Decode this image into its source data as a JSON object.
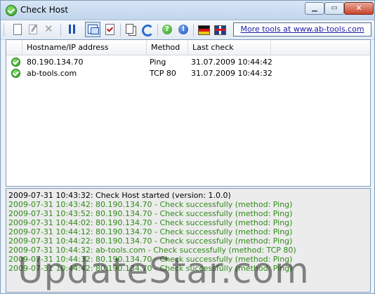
{
  "window": {
    "title": "Check Host"
  },
  "toolbar": {
    "buttons": [
      "new-icon",
      "edit-icon",
      "delete-icon",
      "pause-icon",
      "window-icon",
      "checklist-icon",
      "copy-icon",
      "refresh-icon",
      "help-icon",
      "info-icon",
      "german-flag-icon",
      "uk-flag-icon"
    ],
    "more_tools_label": "More tools at www.ab-tools.com"
  },
  "list": {
    "columns": [
      "Hostname/IP address",
      "Method",
      "Last check"
    ],
    "rows": [
      {
        "host": "80.190.134.70",
        "method": "Ping",
        "last_check": "31.07.2009 10:44:42"
      },
      {
        "host": "ab-tools.com",
        "method": "TCP 80",
        "last_check": "31.07.2009 10:44:32"
      }
    ]
  },
  "log": {
    "lines": [
      "2009-07-31 10:43:32: Check Host started (version: 1.0.0)",
      "2009-07-31 10:43:42: 80.190.134.70 - Check successfully (method: Ping)",
      "2009-07-31 10:43:52: 80.190.134.70 - Check successfully (method: Ping)",
      "2009-07-31 10:44:02: 80.190.134.70 - Check successfully (method: Ping)",
      "2009-07-31 10:44:12: 80.190.134.70 - Check successfully (method: Ping)",
      "2009-07-31 10:44:22: 80.190.134.70 - Check successfully (method: Ping)",
      "2009-07-31 10:44:32: ab-tools.com - Check successfully (method: TCP 80)",
      "2009-07-31 10:44:32: 80.190.134.70 - Check successfully (method: Ping)",
      "2009-07-31 10:44:42: 80.190.134.70 - Check successfully (method: Ping)"
    ]
  },
  "watermark": "UpdateStar.com",
  "colors": {
    "log_success": "#2f8a1a",
    "log_info": "#000000",
    "link": "#1a1aa6"
  }
}
